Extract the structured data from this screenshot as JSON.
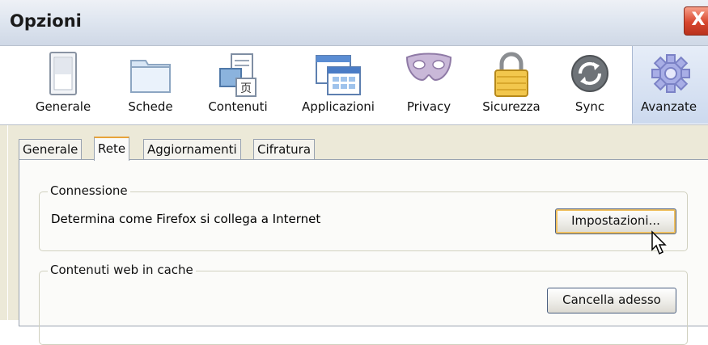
{
  "window": {
    "title": "Opzioni",
    "close_label": "X"
  },
  "toolbar": {
    "items": [
      {
        "label": "Generale",
        "icon": "switch-icon"
      },
      {
        "label": "Schede",
        "icon": "tabs-icon"
      },
      {
        "label": "Contenuti",
        "icon": "contents-icon"
      },
      {
        "label": "Applicazioni",
        "icon": "applications-icon"
      },
      {
        "label": "Privacy",
        "icon": "mask-icon"
      },
      {
        "label": "Sicurezza",
        "icon": "padlock-icon"
      },
      {
        "label": "Sync",
        "icon": "sync-icon"
      },
      {
        "label": "Avanzate",
        "icon": "gear-icon",
        "selected": true
      }
    ]
  },
  "tabs": [
    {
      "label": "Generale"
    },
    {
      "label": "Rete",
      "active": true
    },
    {
      "label": "Aggiornamenti"
    },
    {
      "label": "Cifratura"
    }
  ],
  "connection": {
    "legend": "Connessione",
    "description": "Determina come Firefox si collega a Internet",
    "button_label": "Impostazioni..."
  },
  "cache": {
    "legend": "Contenuti web in cache",
    "button_label": "Cancella adesso"
  }
}
